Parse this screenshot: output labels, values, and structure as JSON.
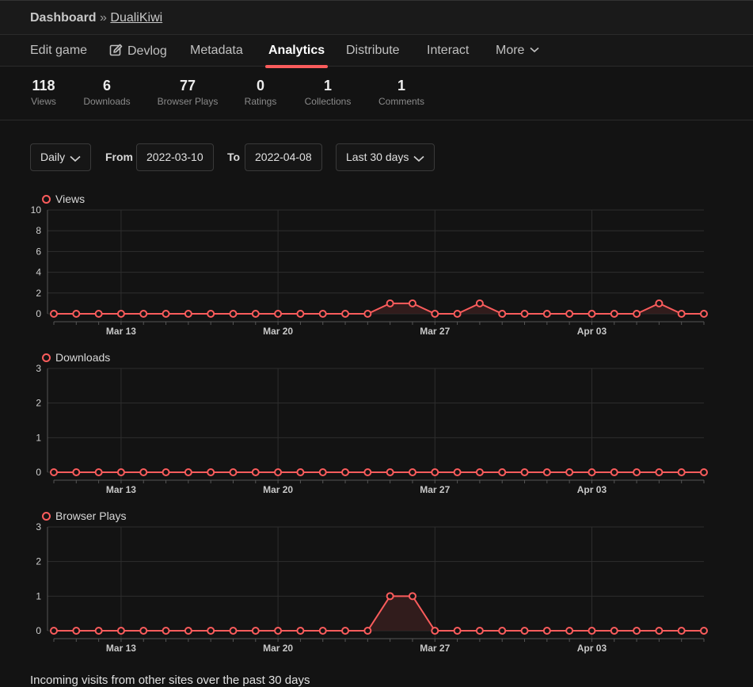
{
  "breadcrumb": {
    "dashboard": "Dashboard",
    "separator": "»",
    "game": "DualiKiwi"
  },
  "tabs": [
    {
      "label": "Edit game",
      "active": false
    },
    {
      "label": "Devlog",
      "active": false,
      "icon": "edit-icon"
    },
    {
      "label": "Metadata",
      "active": false
    },
    {
      "label": "Analytics",
      "active": true
    },
    {
      "label": "Distribute",
      "active": false
    },
    {
      "label": "Interact",
      "active": false
    },
    {
      "label": "More",
      "active": false,
      "icon": "chevron-down-icon"
    }
  ],
  "stats": [
    {
      "value": "118",
      "label": "Views"
    },
    {
      "value": "6",
      "label": "Downloads"
    },
    {
      "value": "77",
      "label": "Browser Plays"
    },
    {
      "value": "0",
      "label": "Ratings"
    },
    {
      "value": "1",
      "label": "Collections"
    },
    {
      "value": "1",
      "label": "Comments"
    }
  ],
  "controls": {
    "interval": "Daily",
    "from_label": "From",
    "from_value": "2022-03-10",
    "to_label": "To",
    "to_value": "2022-04-08",
    "range": "Last 30 days"
  },
  "colors": {
    "accent": "#fa5c5c",
    "background": "#131313",
    "grid": "#2e2e2e"
  },
  "chart_data": [
    {
      "type": "area",
      "title": "Views",
      "x": [
        "2022-03-10",
        "2022-03-11",
        "2022-03-12",
        "2022-03-13",
        "2022-03-14",
        "2022-03-15",
        "2022-03-16",
        "2022-03-17",
        "2022-03-18",
        "2022-03-19",
        "2022-03-20",
        "2022-03-21",
        "2022-03-22",
        "2022-03-23",
        "2022-03-24",
        "2022-03-25",
        "2022-03-26",
        "2022-03-27",
        "2022-03-28",
        "2022-03-29",
        "2022-03-30",
        "2022-03-31",
        "2022-04-01",
        "2022-04-02",
        "2022-04-03",
        "2022-04-04",
        "2022-04-05",
        "2022-04-06",
        "2022-04-07",
        "2022-04-08"
      ],
      "values": [
        0,
        0,
        0,
        0,
        0,
        0,
        0,
        0,
        0,
        0,
        0,
        0,
        0,
        0,
        0,
        1,
        1,
        0,
        0,
        1,
        0,
        0,
        0,
        0,
        0,
        0,
        0,
        1,
        0,
        0
      ],
      "yticks": [
        "0",
        "2",
        "4",
        "6",
        "8",
        "10"
      ],
      "ylim": [
        0,
        10
      ],
      "xticks": [
        {
          "date": "2022-03-13",
          "label": "Mar 13"
        },
        {
          "date": "2022-03-20",
          "label": "Mar 20"
        },
        {
          "date": "2022-03-27",
          "label": "Mar 27"
        },
        {
          "date": "2022-04-03",
          "label": "Apr 03"
        }
      ],
      "grid": true
    },
    {
      "type": "area",
      "title": "Downloads",
      "x": [
        "2022-03-10",
        "2022-03-11",
        "2022-03-12",
        "2022-03-13",
        "2022-03-14",
        "2022-03-15",
        "2022-03-16",
        "2022-03-17",
        "2022-03-18",
        "2022-03-19",
        "2022-03-20",
        "2022-03-21",
        "2022-03-22",
        "2022-03-23",
        "2022-03-24",
        "2022-03-25",
        "2022-03-26",
        "2022-03-27",
        "2022-03-28",
        "2022-03-29",
        "2022-03-30",
        "2022-03-31",
        "2022-04-01",
        "2022-04-02",
        "2022-04-03",
        "2022-04-04",
        "2022-04-05",
        "2022-04-06",
        "2022-04-07",
        "2022-04-08"
      ],
      "values": [
        0,
        0,
        0,
        0,
        0,
        0,
        0,
        0,
        0,
        0,
        0,
        0,
        0,
        0,
        0,
        0,
        0,
        0,
        0,
        0,
        0,
        0,
        0,
        0,
        0,
        0,
        0,
        0,
        0,
        0
      ],
      "yticks": [
        "0",
        "1",
        "2",
        "3"
      ],
      "ylim": [
        0,
        3
      ],
      "xticks": [
        {
          "date": "2022-03-13",
          "label": "Mar 13"
        },
        {
          "date": "2022-03-20",
          "label": "Mar 20"
        },
        {
          "date": "2022-03-27",
          "label": "Mar 27"
        },
        {
          "date": "2022-04-03",
          "label": "Apr 03"
        }
      ],
      "grid": true
    },
    {
      "type": "area",
      "title": "Browser Plays",
      "x": [
        "2022-03-10",
        "2022-03-11",
        "2022-03-12",
        "2022-03-13",
        "2022-03-14",
        "2022-03-15",
        "2022-03-16",
        "2022-03-17",
        "2022-03-18",
        "2022-03-19",
        "2022-03-20",
        "2022-03-21",
        "2022-03-22",
        "2022-03-23",
        "2022-03-24",
        "2022-03-25",
        "2022-03-26",
        "2022-03-27",
        "2022-03-28",
        "2022-03-29",
        "2022-03-30",
        "2022-03-31",
        "2022-04-01",
        "2022-04-02",
        "2022-04-03",
        "2022-04-04",
        "2022-04-05",
        "2022-04-06",
        "2022-04-07",
        "2022-04-08"
      ],
      "values": [
        0,
        0,
        0,
        0,
        0,
        0,
        0,
        0,
        0,
        0,
        0,
        0,
        0,
        0,
        0,
        1,
        1,
        0,
        0,
        0,
        0,
        0,
        0,
        0,
        0,
        0,
        0,
        0,
        0,
        0
      ],
      "yticks": [
        "0",
        "1",
        "2",
        "3"
      ],
      "ylim": [
        0,
        3
      ],
      "xticks": [
        {
          "date": "2022-03-13",
          "label": "Mar 13"
        },
        {
          "date": "2022-03-20",
          "label": "Mar 20"
        },
        {
          "date": "2022-03-27",
          "label": "Mar 27"
        },
        {
          "date": "2022-04-03",
          "label": "Apr 03"
        }
      ],
      "grid": true
    }
  ],
  "footer": {
    "text": "Incoming visits from other sites over the past 30 days"
  }
}
